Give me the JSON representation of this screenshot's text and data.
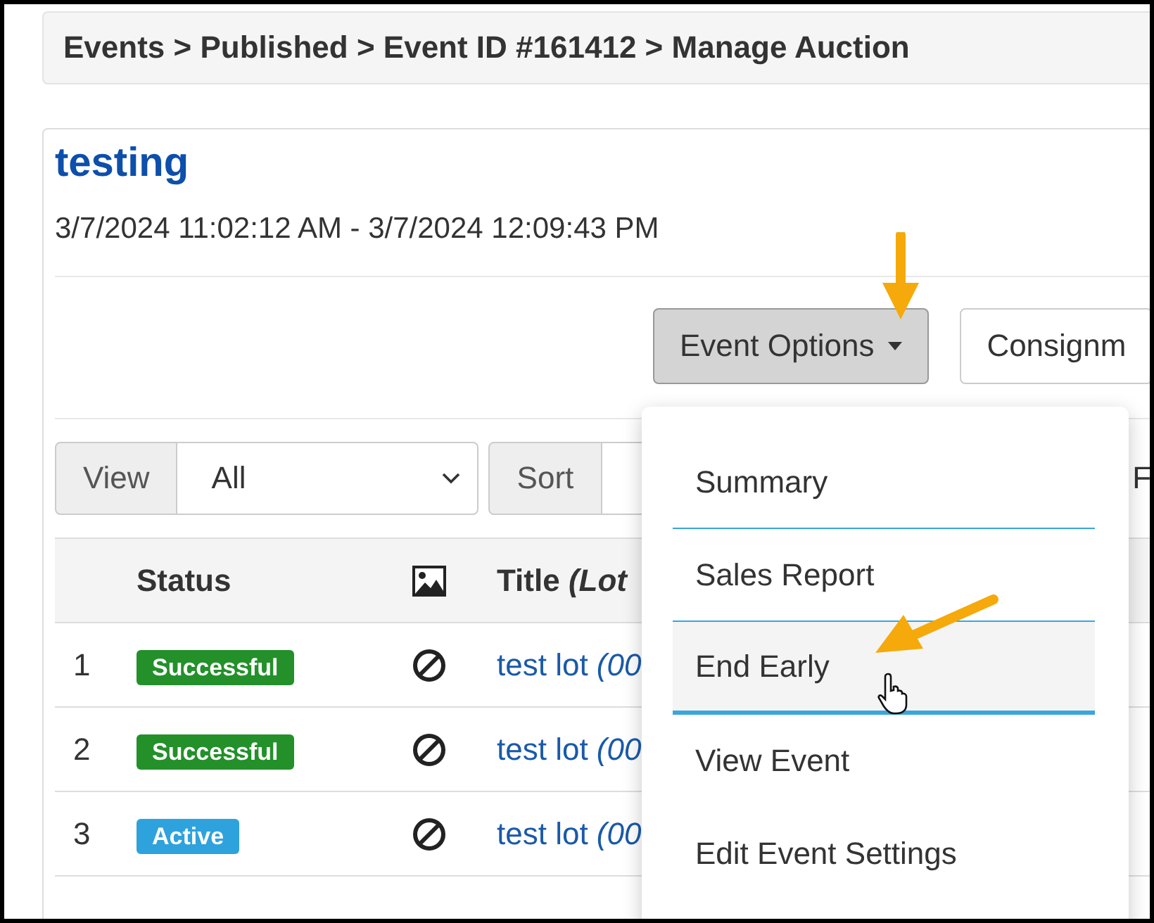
{
  "breadcrumb": "Events > Published > Event ID #161412 > Manage Auction",
  "event": {
    "title": "testing",
    "dates": "3/7/2024 11:02:12 AM - 3/7/2024 12:09:43 PM"
  },
  "buttons": [
    {
      "label": "Event Options",
      "caret": true,
      "pressed": true
    },
    {
      "label": "Consignm",
      "caret": false,
      "pressed": false
    }
  ],
  "filters": {
    "view_label": "View",
    "view_value": "All",
    "sort_label": "Sort",
    "column_3": "F"
  },
  "table": {
    "columns": [
      "Status",
      "Title *(Lot*"
    ],
    "rows": [
      {
        "number": "1",
        "status": "Successful",
        "color": "#23902a",
        "title": "test lot *(00*"
      },
      {
        "number": "2",
        "status": "Successful",
        "color": "#23902a",
        "title": "test lot *(00*"
      },
      {
        "number": "3",
        "status": "Active",
        "color": "#2ea2dd",
        "title": "test lot *(00*"
      }
    ]
  },
  "menu": {
    "items": [
      {
        "label": "Summary",
        "highlighted": false,
        "divider_after": true
      },
      {
        "label": "Sales Report",
        "highlighted": false,
        "divider_after": true
      },
      {
        "label": "End Early",
        "highlighted": true,
        "divider_after": true
      },
      {
        "label": "View Event",
        "highlighted": false,
        "divider_after": false
      },
      {
        "label": "Edit Event Settings",
        "highlighted": false,
        "divider_after": false
      }
    ]
  }
}
